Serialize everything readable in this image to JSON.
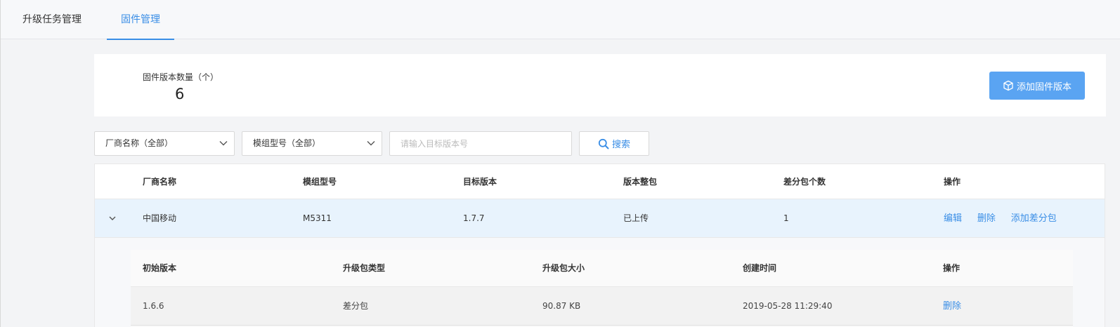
{
  "tabs": [
    {
      "label": "升级任务管理",
      "active": false
    },
    {
      "label": "固件管理",
      "active": true
    }
  ],
  "summary": {
    "label": "固件版本数量（个）",
    "value": "6",
    "add_button": {
      "label": "添加固件版本",
      "icon": "cube-icon"
    }
  },
  "filters": {
    "vendor_select": "厂商名称（全部）",
    "model_select": "模组型号（全部）",
    "version_placeholder": "请输入目标版本号",
    "search_button": "搜索"
  },
  "table": {
    "headers": [
      "厂商名称",
      "模组型号",
      "目标版本",
      "版本整包",
      "差分包个数",
      "操作"
    ],
    "rows": [
      {
        "vendor": "中国移动",
        "model": "M5311",
        "target_version": "1.7.7",
        "full_package": "已上传",
        "diff_count": "1",
        "actions": [
          "编辑",
          "删除",
          "添加差分包"
        ]
      }
    ]
  },
  "subtable": {
    "headers": [
      "初始版本",
      "升级包类型",
      "升级包大小",
      "创建时间",
      "操作"
    ],
    "rows": [
      {
        "initial_version": "1.6.6",
        "package_type": "差分包",
        "package_size": "90.87 KB",
        "created_at": "2019-05-28 11:29:40",
        "action": "删除"
      }
    ]
  },
  "colors": {
    "accent": "#3a8ee6",
    "primary_button": "#5aa4f2",
    "row_highlight": "#e8f3fd"
  }
}
